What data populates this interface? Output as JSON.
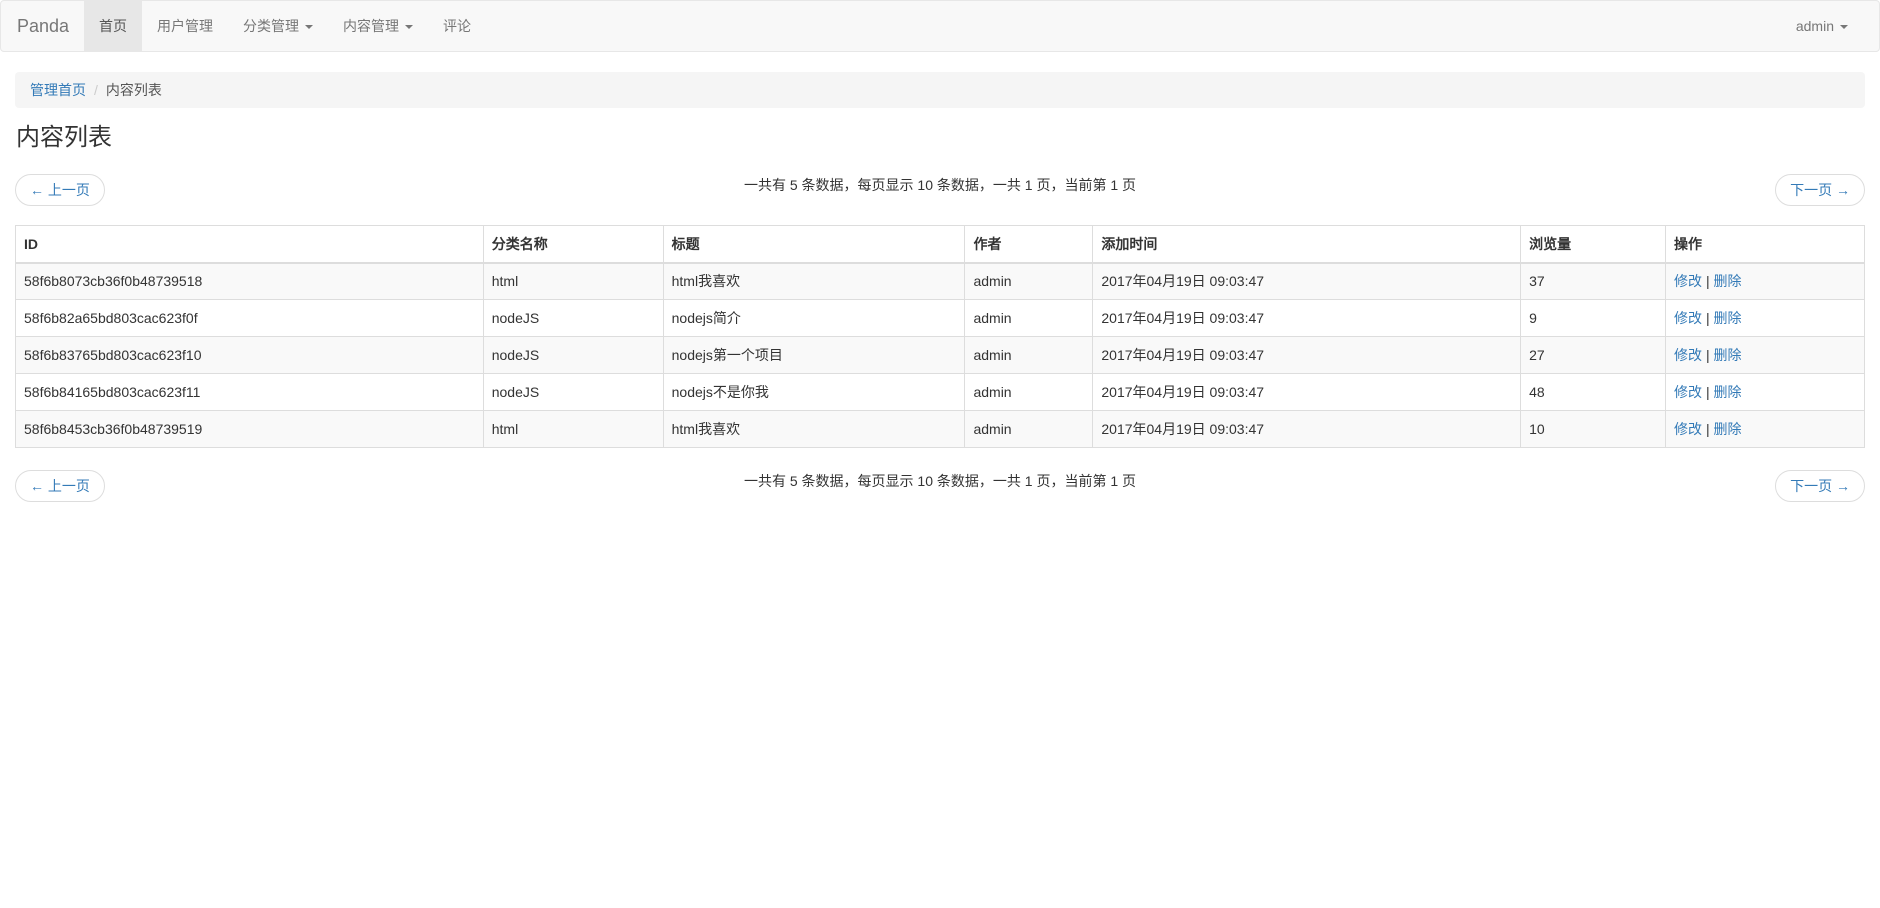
{
  "navbar": {
    "brand": "Panda",
    "items": [
      {
        "label": "首页",
        "active": true
      },
      {
        "label": "用户管理"
      },
      {
        "label": "分类管理"
      },
      {
        "label": "内容管理"
      },
      {
        "label": "评论"
      }
    ],
    "user": "admin"
  },
  "breadcrumb": {
    "home": "管理首页",
    "separator": "/",
    "current": "内容列表"
  },
  "page_title": "内容列表",
  "pager": {
    "prev": "← 上一页",
    "next": "下一页 →",
    "info": "一共有 5 条数据，每页显示 10 条数据，一共 1 页，当前第 1 页"
  },
  "table": {
    "headers": [
      "ID",
      "分类名称",
      "标题",
      "作者",
      "添加时间",
      "浏览量",
      "操作"
    ],
    "rows": [
      {
        "id": "58f6b8073cb36f0b48739518",
        "category": "html",
        "title": "html我喜欢",
        "author": "admin",
        "time": "2017年04月19日 09:03:47",
        "views": "37"
      },
      {
        "id": "58f6b82a65bd803cac623f0f",
        "category": "nodeJS",
        "title": "nodejs简介",
        "author": "admin",
        "time": "2017年04月19日 09:03:47",
        "views": "9"
      },
      {
        "id": "58f6b83765bd803cac623f10",
        "category": "nodeJS",
        "title": "nodejs第一个项目",
        "author": "admin",
        "time": "2017年04月19日 09:03:47",
        "views": "27"
      },
      {
        "id": "58f6b84165bd803cac623f11",
        "category": "nodeJS",
        "title": "nodejs不是你我",
        "author": "admin",
        "time": "2017年04月19日 09:03:47",
        "views": "48"
      },
      {
        "id": "58f6b8453cb36f0b48739519",
        "category": "html",
        "title": "html我喜欢",
        "author": "admin",
        "time": "2017年04月19日 09:03:47",
        "views": "10"
      }
    ],
    "action_edit": "修改",
    "action_sep": "|",
    "action_delete": "删除"
  }
}
